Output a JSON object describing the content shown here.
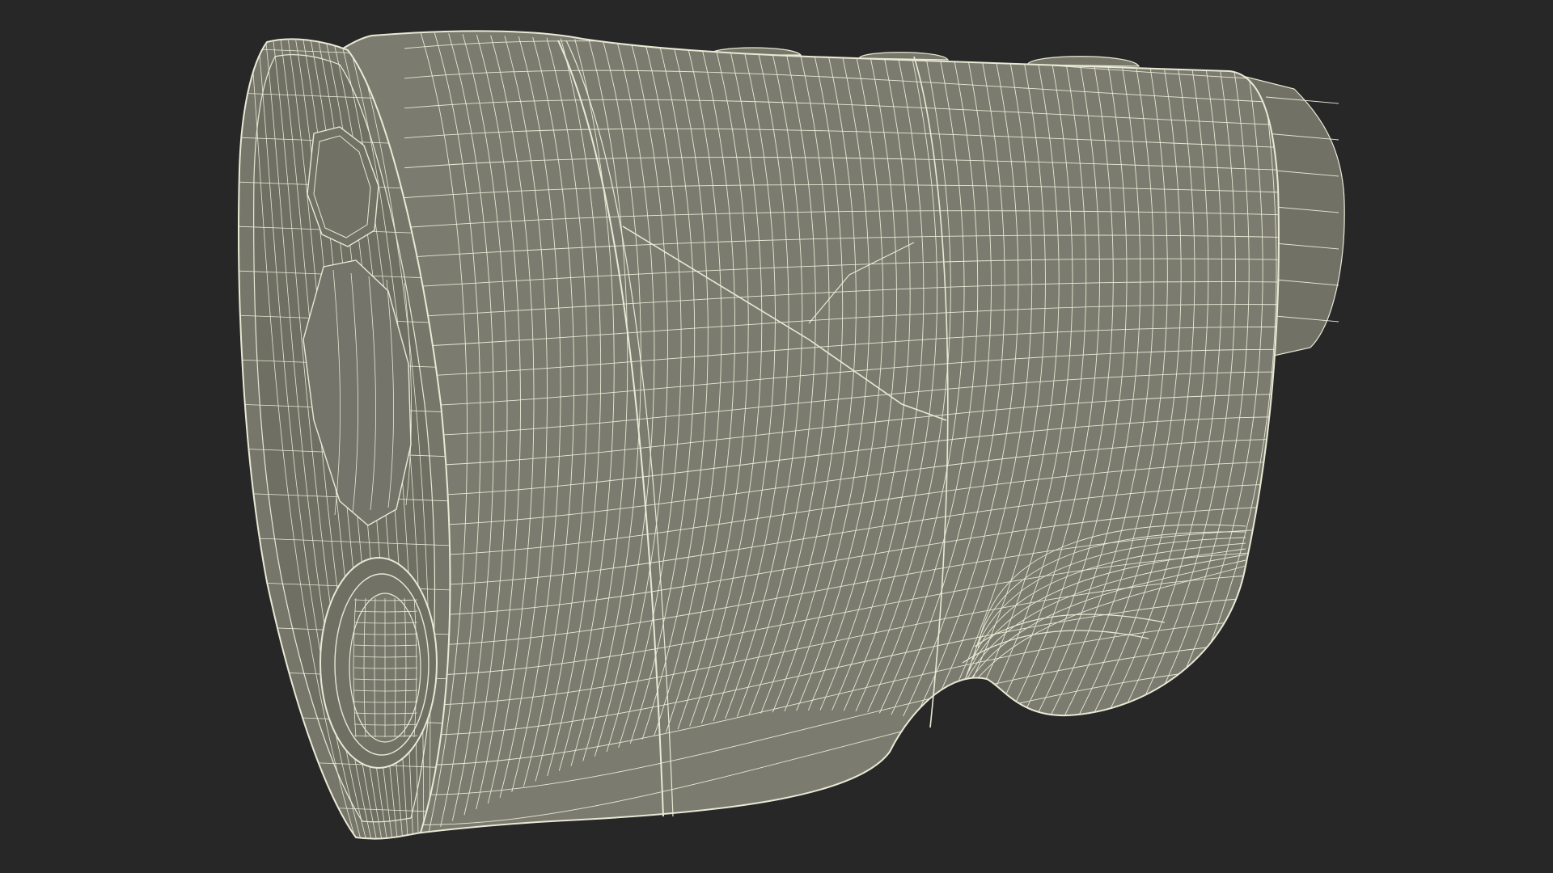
{
  "scene": {
    "background_color": "#272727",
    "subject": "rangefinder-wireframe-model",
    "body_fill": "#7b7b6f",
    "body_shade": "#6c6c61",
    "wire_color": "#e9e9d6",
    "buttons": [
      "top-button-1",
      "top-button-2",
      "top-button-3"
    ]
  }
}
